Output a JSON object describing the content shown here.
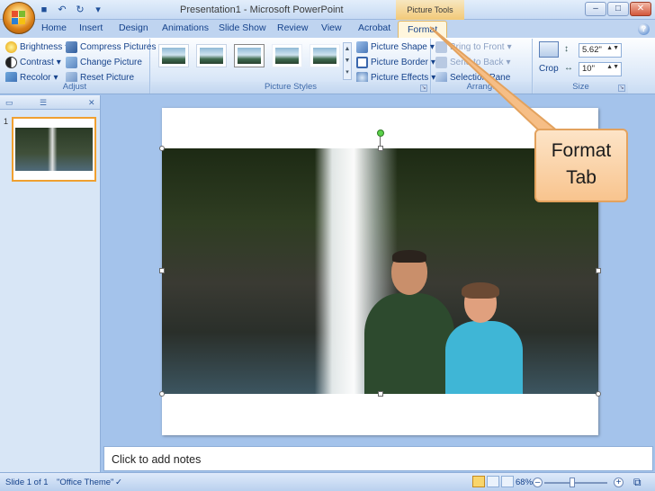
{
  "window": {
    "title": "Presentation1 - Microsoft PowerPoint",
    "contextual_tab_group": "Picture Tools",
    "controls": [
      "minimize",
      "maximize",
      "close"
    ]
  },
  "tabs": [
    {
      "label": "Home",
      "active": false
    },
    {
      "label": "Insert",
      "active": false
    },
    {
      "label": "Design",
      "active": false
    },
    {
      "label": "Animations",
      "active": false
    },
    {
      "label": "Slide Show",
      "active": false
    },
    {
      "label": "Review",
      "active": false
    },
    {
      "label": "View",
      "active": false
    },
    {
      "label": "Acrobat",
      "active": false
    },
    {
      "label": "Format",
      "active": true
    }
  ],
  "ribbon": {
    "adjust": {
      "label": "Adjust",
      "brightness": "Brightness",
      "contrast": "Contrast",
      "recolor": "Recolor",
      "compress": "Compress Pictures",
      "change": "Change Picture",
      "reset": "Reset Picture"
    },
    "picture_styles": {
      "label": "Picture Styles",
      "shape": "Picture Shape",
      "border": "Picture Border",
      "effects": "Picture Effects"
    },
    "arrange": {
      "label": "Arrange",
      "bring_front": "Bring to Front",
      "send_back": "Send to Back",
      "selection_pane": "Selection Pane"
    },
    "size": {
      "label": "Size",
      "crop": "Crop",
      "height": "5.62\"",
      "width": "10\""
    }
  },
  "slides_panel": {
    "slide_number": "1"
  },
  "callout": {
    "line1": "Format",
    "line2": "Tab"
  },
  "notes": {
    "placeholder": "Click to add notes"
  },
  "status": {
    "slide_info": "Slide 1 of 1",
    "theme": "\"Office Theme\"",
    "zoom": "68%"
  }
}
